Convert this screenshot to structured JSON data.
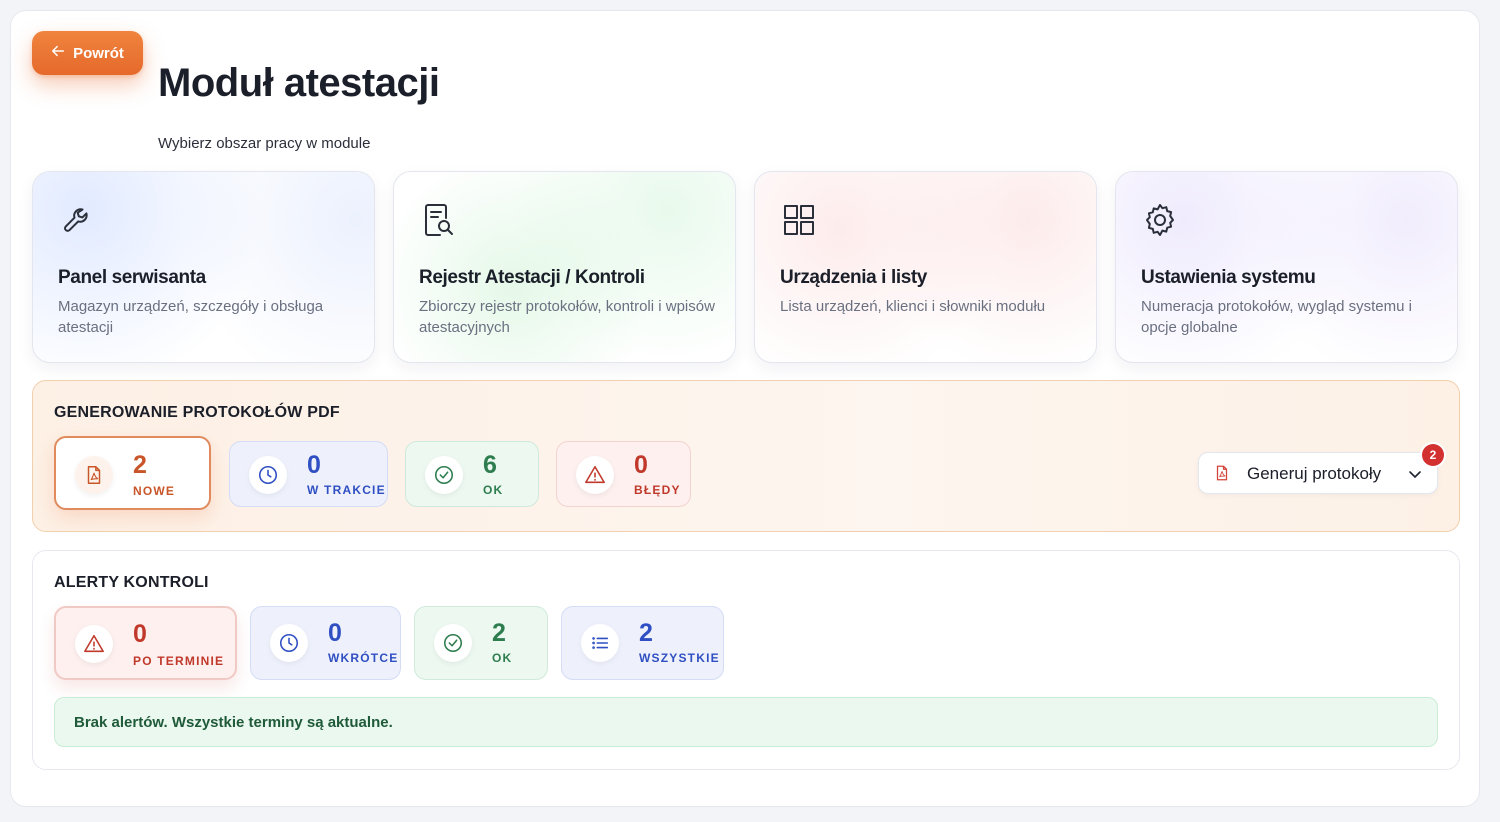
{
  "header": {
    "back_label": "Powrót",
    "title": "Moduł atestacji",
    "subtitle": "Wybierz obszar pracy w module"
  },
  "cards": [
    {
      "title": "Panel serwisanta",
      "description": "Magazyn urządzeń, szczegóły i obsługa atestacji",
      "icon": "wrench-icon"
    },
    {
      "title": "Rejestr Atestacji / Kontroli",
      "description": "Zbiorczy rejestr protokołów, kontroli i wpisów atestacyjnych",
      "icon": "document-search-icon"
    },
    {
      "title": "Urządzenia i listy",
      "description": "Lista urządzeń, klienci i słowniki modułu",
      "icon": "grid-icon"
    },
    {
      "title": "Ustawienia systemu",
      "description": "Numeracja protokołów, wygląd systemu i opcje globalne",
      "icon": "gear-icon"
    }
  ],
  "pdf": {
    "title": "GENEROWANIE PROTOKOŁÓW PDF",
    "stats": [
      {
        "value": "2",
        "label": "NOWE",
        "icon": "pdf-file-icon",
        "color": "#c8562a"
      },
      {
        "value": "0",
        "label": "W TRAKCIE",
        "icon": "clock-icon",
        "color": "#2f4fc2"
      },
      {
        "value": "6",
        "label": "OK",
        "icon": "check-circle-icon",
        "color": "#2e7d4f"
      },
      {
        "value": "0",
        "label": "BŁĘDY",
        "icon": "warning-icon",
        "color": "#c0392b"
      }
    ],
    "generate_label": "Generuj protokoły",
    "generate_badge": "2"
  },
  "alerts": {
    "title": "ALERTY KONTROLI",
    "stats": [
      {
        "value": "0",
        "label": "PO TERMINIE",
        "icon": "warning-icon",
        "color": "#c0392b"
      },
      {
        "value": "0",
        "label": "WKRÓTCE",
        "icon": "clock-icon",
        "color": "#2f4fc2"
      },
      {
        "value": "2",
        "label": "OK",
        "icon": "check-circle-icon",
        "color": "#2e7d4f"
      },
      {
        "value": "2",
        "label": "WSZYSTKIE",
        "icon": "list-icon",
        "color": "#2f4fc2"
      }
    ],
    "message": "Brak alertów. Wszystkie terminy są aktualne."
  },
  "colors": {
    "accent": "#e86e30",
    "danger": "#d33030",
    "success_bg": "#ebf8ef"
  }
}
